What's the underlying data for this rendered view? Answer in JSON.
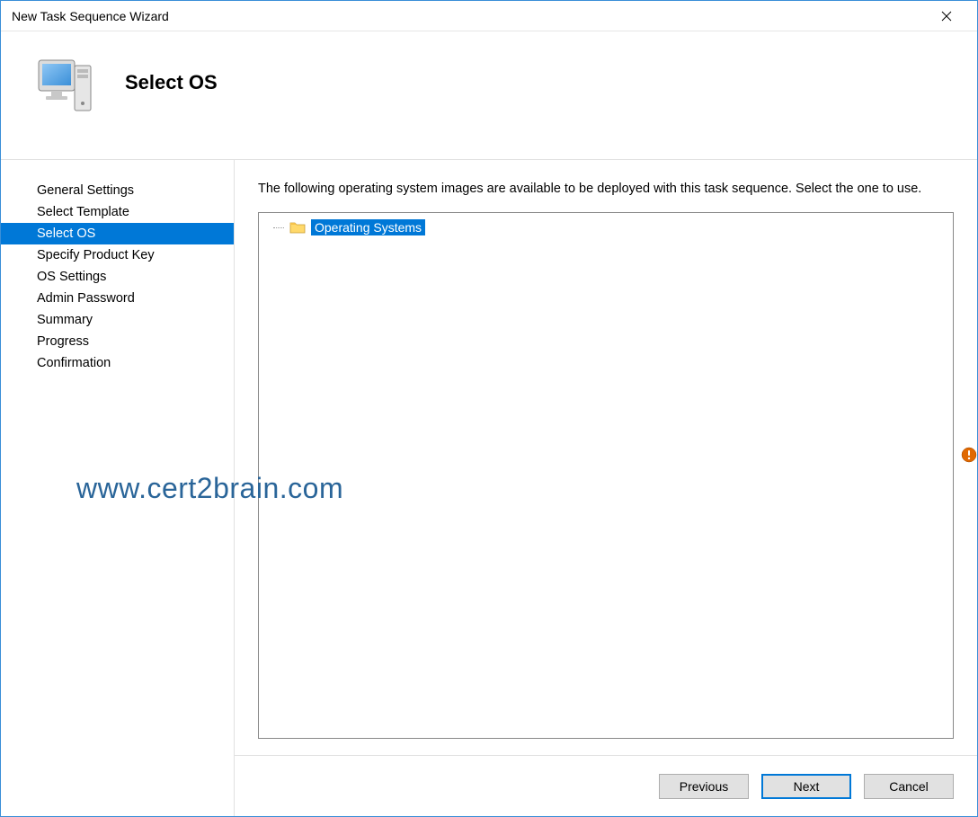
{
  "window": {
    "title": "New Task Sequence Wizard"
  },
  "header": {
    "title": "Select OS"
  },
  "sidebar": {
    "items": [
      {
        "label": "General Settings",
        "selected": false
      },
      {
        "label": "Select Template",
        "selected": false
      },
      {
        "label": "Select OS",
        "selected": true
      },
      {
        "label": "Specify Product Key",
        "selected": false
      },
      {
        "label": "OS Settings",
        "selected": false
      },
      {
        "label": "Admin Password",
        "selected": false
      },
      {
        "label": "Summary",
        "selected": false
      },
      {
        "label": "Progress",
        "selected": false
      },
      {
        "label": "Confirmation",
        "selected": false
      }
    ]
  },
  "main": {
    "instruction": "The following operating system images are available to be deployed with this task sequence.  Select the one to use.",
    "tree": {
      "root_label": "Operating Systems"
    }
  },
  "buttons": {
    "previous": "Previous",
    "next": "Next",
    "cancel": "Cancel"
  },
  "watermark": "www.cert2brain.com"
}
